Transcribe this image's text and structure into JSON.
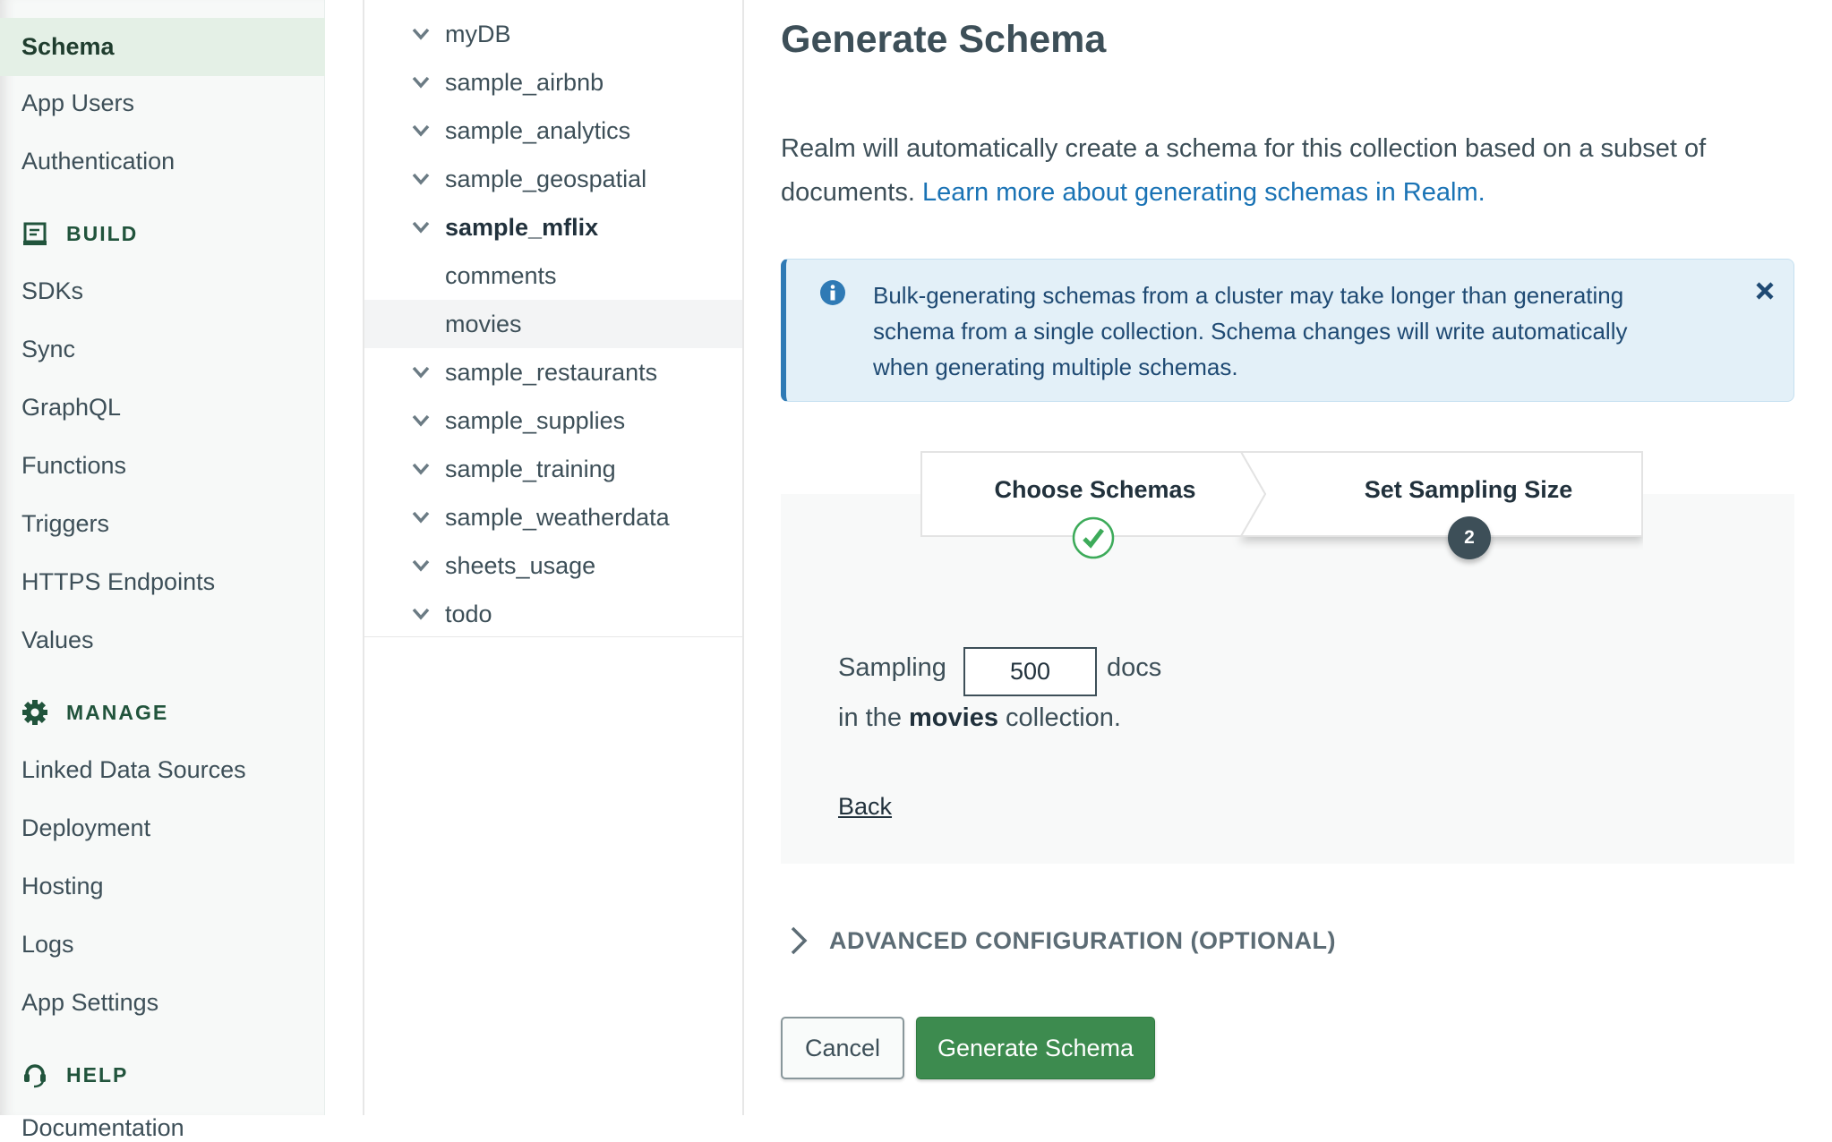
{
  "sidebar": {
    "items_top": [
      "Schema",
      "App Users",
      "Authentication"
    ],
    "build": {
      "label": "BUILD",
      "icon": "build-icon",
      "items": [
        "SDKs",
        "Sync",
        "GraphQL",
        "Functions",
        "Triggers",
        "HTTPS Endpoints",
        "Values"
      ]
    },
    "manage": {
      "label": "MANAGE",
      "icon": "gear-icon",
      "items": [
        "Linked Data Sources",
        "Deployment",
        "Hosting",
        "Logs",
        "App Settings"
      ]
    },
    "help": {
      "label": "HELP",
      "icon": "headset-icon",
      "items": [
        "Documentation"
      ]
    },
    "active": "Schema"
  },
  "tree": {
    "items": [
      {
        "label": "myDB",
        "expandable": true
      },
      {
        "label": "sample_airbnb",
        "expandable": true
      },
      {
        "label": "sample_analytics",
        "expandable": true
      },
      {
        "label": "sample_geospatial",
        "expandable": true
      },
      {
        "label": "sample_mflix",
        "expandable": true,
        "bold": true
      },
      {
        "label": "comments",
        "expandable": false
      },
      {
        "label": "movies",
        "expandable": false,
        "selected": true
      },
      {
        "label": "sample_restaurants",
        "expandable": true
      },
      {
        "label": "sample_supplies",
        "expandable": true
      },
      {
        "label": "sample_training",
        "expandable": true
      },
      {
        "label": "sample_weatherdata",
        "expandable": true
      },
      {
        "label": "sheets_usage",
        "expandable": true
      },
      {
        "label": "todo",
        "expandable": true
      }
    ]
  },
  "main": {
    "title": "Generate Schema",
    "intro": "Realm will automatically create a schema for this collection based on a subset of documents.",
    "intro_link": "Learn more about generating schemas in Realm.",
    "info": {
      "text": "Bulk-generating schemas from a cluster may take longer than generating schema from a single collection. Schema changes will write automatically when generating multiple schemas."
    },
    "steps": [
      {
        "label": "Choose Schemas",
        "status": "complete"
      },
      {
        "label": "Set Sampling Size",
        "number": "2",
        "status": "current"
      }
    ],
    "sampling": {
      "prefix": "Sampling",
      "value": "500",
      "suffix": "docs",
      "line2_pre": "in the",
      "collection": "movies",
      "line2_post": "collection."
    },
    "back": "Back",
    "advanced": "ADVANCED CONFIGURATION (OPTIONAL)",
    "cancel": "Cancel",
    "generate": "Generate Schema"
  },
  "colors": {
    "accent": "#3d8b4f",
    "info_bg": "#e3f0f8",
    "info_border": "#2f7ab5",
    "sidebar_active": "#e4f0e6"
  }
}
